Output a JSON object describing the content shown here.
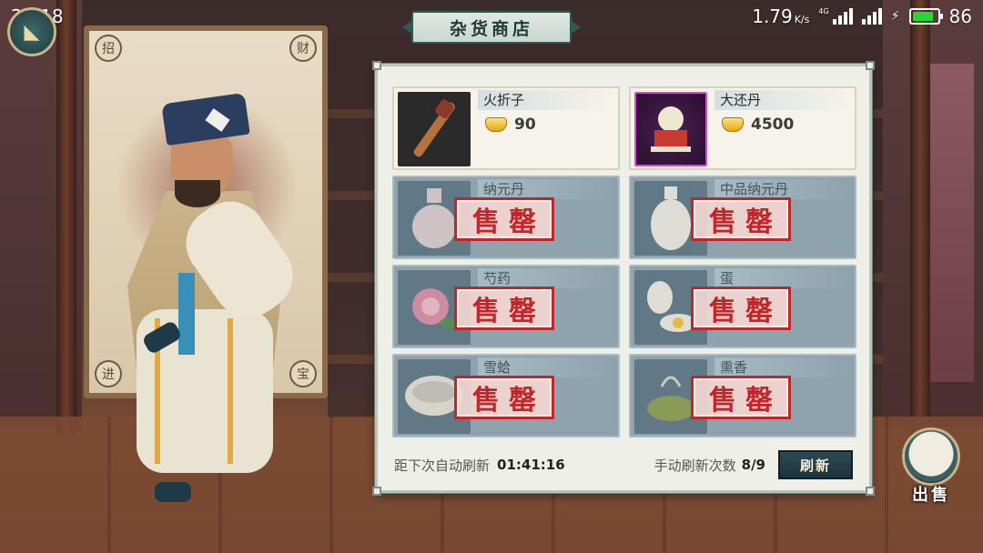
{
  "status_bar": {
    "time": "22:18",
    "net_speed": "1.79",
    "net_unit": "K/s",
    "signal_tag": "4G",
    "battery_level": "86"
  },
  "shop": {
    "title": "杂货商店",
    "items": [
      {
        "name": "火折子",
        "price": "90",
        "sold_out": false,
        "icon": "fire-starter-icon"
      },
      {
        "name": "大还丹",
        "price": "4500",
        "sold_out": false,
        "icon": "pill-icon"
      },
      {
        "name": "纳元丹",
        "sold_out": true,
        "icon": "potion-bottle-icon"
      },
      {
        "name": "中品纳元丹",
        "sold_out": true,
        "icon": "vase-icon"
      },
      {
        "name": "芍药",
        "sold_out": true,
        "icon": "peony-icon"
      },
      {
        "name": "蛋",
        "sold_out": true,
        "icon": "egg-icon"
      },
      {
        "name": "雪蛤",
        "sold_out": true,
        "icon": "bowl-icon"
      },
      {
        "name": "熏香",
        "sold_out": true,
        "icon": "incense-burner-icon"
      }
    ],
    "sold_out_label": "售罄",
    "footer": {
      "auto_refresh_label": "距下次自动刷新",
      "auto_refresh_time": "01:41:16",
      "manual_refresh_label": "手动刷新次数",
      "manual_refresh_count": "8/9",
      "refresh_button": "刷新"
    }
  },
  "sell_button": {
    "label": "出售"
  },
  "scroll_seals": [
    "招",
    "财",
    "进",
    "宝"
  ],
  "colors": {
    "sold_out_red": "#c0272b",
    "rare_border": "#d44ad4",
    "panel_bg": "#eef0e8",
    "battery_green": "#29d63a"
  }
}
